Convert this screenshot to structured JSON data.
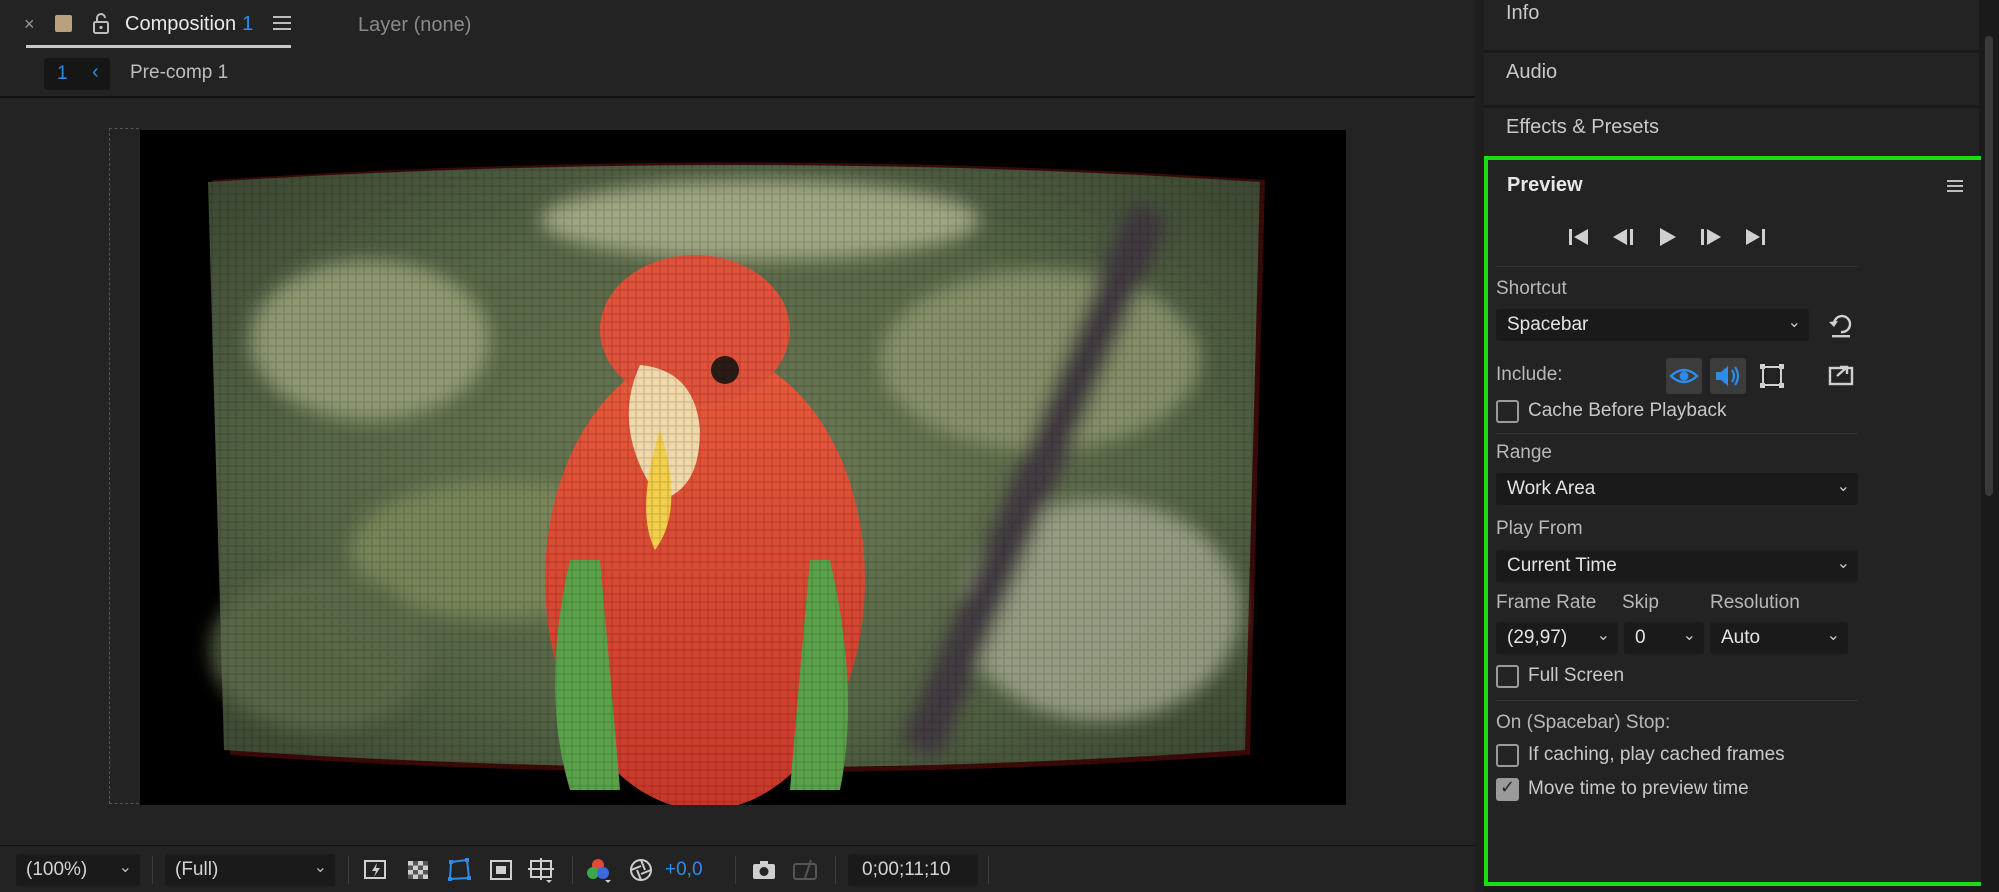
{
  "composition_tab": {
    "close_glyph": "×",
    "title": "Composition",
    "number": "1",
    "swatch_color": "#b9a07e",
    "active_underline_color": "#c8c8c8"
  },
  "layer_tab": {
    "label": "Layer (none)"
  },
  "breadcrumb": {
    "index": "1",
    "chevron": "‹",
    "item": "Pre-comp 1"
  },
  "viewer_footer": {
    "magnification": "(100%)",
    "resolution": "(Full)",
    "exposure": "+0,0",
    "timecode": "0;00;11;10",
    "icons": [
      "fast-previews-icon",
      "transparency-grid-icon",
      "mask-path-visibility-icon",
      "region-of-interest-icon",
      "grid-guides-icon",
      "show-channel-icon",
      "reset-exposure-icon",
      "snapshot-camera-icon",
      "show-snapshot-icon"
    ]
  },
  "right_panels": {
    "info": "Info",
    "audio": "Audio",
    "effects": "Effects & Presets"
  },
  "preview": {
    "title": "Preview",
    "highlight_color": "#1edc14",
    "transport": [
      "first-frame-icon",
      "previous-frame-icon",
      "play-icon",
      "next-frame-icon",
      "last-frame-icon"
    ],
    "shortcut_label": "Shortcut",
    "shortcut_value": "Spacebar",
    "include_label": "Include:",
    "include": {
      "video": true,
      "audio": true,
      "overlays": false
    },
    "cache_before_playback": {
      "label": "Cache Before Playback",
      "checked": false
    },
    "range_label": "Range",
    "range_value": "Work Area",
    "play_from_label": "Play From",
    "play_from_value": "Current Time",
    "frame_rate_label": "Frame Rate",
    "frame_rate_value": "(29,97)",
    "skip_label": "Skip",
    "skip_value": "0",
    "resolution_label": "Resolution",
    "resolution_value": "Auto",
    "full_screen": {
      "label": "Full Screen",
      "checked": false
    },
    "on_stop_label": "On (Spacebar) Stop:",
    "if_caching": {
      "label": "If caching, play cached frames",
      "checked": false
    },
    "move_time": {
      "label": "Move time to preview time",
      "checked": true
    }
  },
  "colors": {
    "accent_blue": "#2d8ceb",
    "panel_bg": "#232323"
  }
}
